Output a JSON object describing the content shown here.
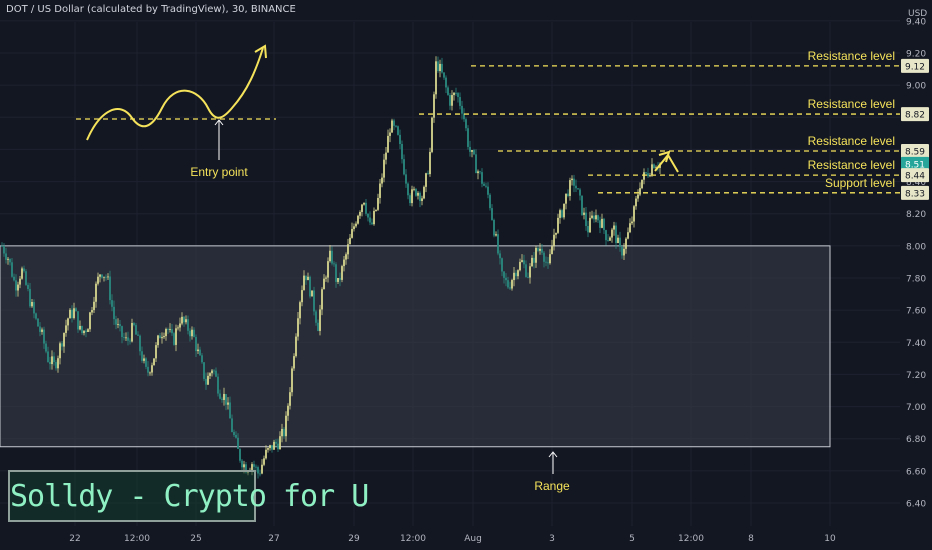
{
  "header": {
    "title": "DOT / US Dollar (calculated by TradingView), 30, BINANCE"
  },
  "watermark": "Solldy - Crypto for U",
  "colors": {
    "background": "#131722",
    "up": "#d8d890",
    "down": "#2a8a80",
    "annotation": "#f5e35b",
    "range_fill": "#3a3e4a",
    "current_price_badge": "#26a69a"
  },
  "chart_data": {
    "type": "candlestick",
    "title": "DOT / US Dollar (calculated by TradingView), 30, BINANCE",
    "price_axis_label": "USD",
    "ylim": [
      6.25,
      9.48
    ],
    "y_ticks": [
      "9.40",
      "9.20",
      "9.00",
      "8.80",
      "8.60",
      "8.40",
      "8.20",
      "8.00",
      "7.80",
      "7.60",
      "7.40",
      "7.20",
      "7.00",
      "6.80",
      "6.60",
      "6.40"
    ],
    "x_ticks": [
      "22",
      "12:00",
      "25",
      "27",
      "29",
      "12:00",
      "Aug",
      "3",
      "5",
      "12:00",
      "8",
      "10"
    ],
    "price_path": [
      8.0,
      7.92,
      7.75,
      7.85,
      7.7,
      7.55,
      7.45,
      7.3,
      7.25,
      7.4,
      7.55,
      7.6,
      7.45,
      7.5,
      7.7,
      7.85,
      7.8,
      7.55,
      7.45,
      7.4,
      7.5,
      7.35,
      7.2,
      7.3,
      7.45,
      7.5,
      7.4,
      7.55,
      7.5,
      7.45,
      7.3,
      7.15,
      7.25,
      7.1,
      7.05,
      6.85,
      6.7,
      6.62,
      6.65,
      6.58,
      6.7,
      6.75,
      6.78,
      6.85,
      7.2,
      7.6,
      7.85,
      7.7,
      7.5,
      7.8,
      7.95,
      7.75,
      7.9,
      8.05,
      8.2,
      8.3,
      8.1,
      8.25,
      8.5,
      8.75,
      8.7,
      8.5,
      8.3,
      8.35,
      8.3,
      8.55,
      9.15,
      9.05,
      8.9,
      8.95,
      8.85,
      8.6,
      8.5,
      8.4,
      8.3,
      8.05,
      7.8,
      7.75,
      7.85,
      7.9,
      7.82,
      7.95,
      8.0,
      7.85,
      8.1,
      8.2,
      8.35,
      8.4,
      8.25,
      8.1,
      8.2,
      8.15,
      8.05,
      8.1,
      7.95,
      8.05,
      8.2,
      8.4,
      8.45,
      8.52,
      8.51
    ],
    "price_labels": [
      {
        "value": 9.12,
        "text": "9.12",
        "kind": "level"
      },
      {
        "value": 8.82,
        "text": "8.82",
        "kind": "level"
      },
      {
        "value": 8.59,
        "text": "8.59",
        "kind": "level"
      },
      {
        "value": 8.51,
        "text": "8.51",
        "kind": "current"
      },
      {
        "value": 8.44,
        "text": "8.44",
        "kind": "level"
      },
      {
        "value": 8.33,
        "text": "8.33",
        "kind": "level"
      }
    ],
    "levels": [
      {
        "value": 9.12,
        "label": "Resistance level"
      },
      {
        "value": 8.82,
        "label": "Resistance level"
      },
      {
        "value": 8.59,
        "label": "Resistance level"
      },
      {
        "value": 8.44,
        "label": "Resistance level"
      },
      {
        "value": 8.33,
        "label": "Support level"
      }
    ],
    "range_box": {
      "high": 8.0,
      "low": 6.75,
      "label": "Range"
    },
    "entry": {
      "value": 8.82,
      "label": "Entry point"
    }
  }
}
